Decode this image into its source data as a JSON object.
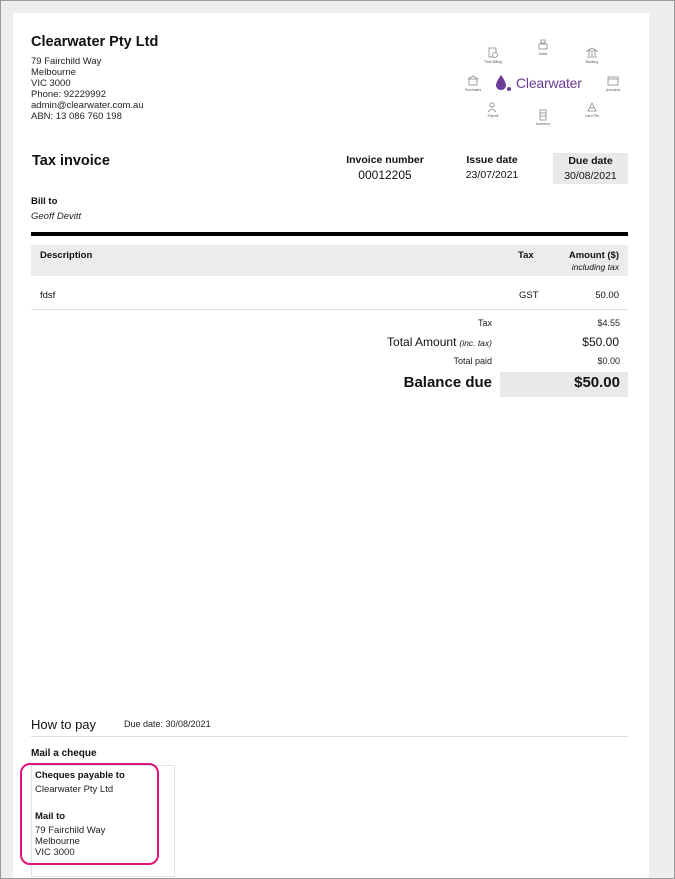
{
  "company": {
    "name": "Clearwater Pty Ltd",
    "address_line1": "79 Fairchild Way",
    "address_line2": "Melbourne",
    "address_line3": "VIC 3000",
    "phone": "Phone: 92229992",
    "email": "admin@clearwater.com.au",
    "abn": "ABN: 13 086 760 198"
  },
  "logo": {
    "brand": "Clearwater",
    "brand_color": "#6a3c96",
    "icons": [
      {
        "label": "Time Billing",
        "icon": "timer-icon"
      },
      {
        "label": "Sales",
        "icon": "cash-register-icon"
      },
      {
        "label": "Banking",
        "icon": "bank-icon"
      },
      {
        "label": "Purchases",
        "icon": "store-icon"
      },
      {
        "label": "Accounts",
        "icon": "folder-icon"
      },
      {
        "label": "Payroll",
        "icon": "people-icon"
      },
      {
        "label": "Inventory",
        "icon": "boxes-icon"
      },
      {
        "label": "Card File",
        "icon": "contacts-icon"
      }
    ]
  },
  "invoice": {
    "title": "Tax invoice",
    "number_label": "Invoice number",
    "number": "00012205",
    "issue_label": "Issue date",
    "issue_date": "23/07/2021",
    "due_label": "Due date",
    "due_date": "30/08/2021",
    "bill_to_label": "Bill to",
    "bill_to": "Geoff Devitt"
  },
  "table": {
    "col_description": "Description",
    "col_tax": "Tax",
    "col_amount": "Amount ($)",
    "col_amount_sub": "including tax",
    "rows": [
      {
        "description": "fdsf",
        "tax": "GST",
        "amount": "50.00"
      }
    ]
  },
  "totals": {
    "tax_label": "Tax",
    "tax": "$4.55",
    "total_label": "Total Amount",
    "total_note": "(inc. tax)",
    "total": "$50.00",
    "paid_label": "Total paid",
    "paid": "$0.00",
    "balance_label": "Balance due",
    "balance": "$50.00"
  },
  "how_to_pay": {
    "title": "How to pay",
    "due": "Due date: 30/08/2021",
    "method_title": "Mail a cheque",
    "payable_label": "Cheques payable to",
    "payable_to": "Clearwater Pty Ltd",
    "mail_label": "Mail to",
    "mail_line1": "79 Fairchild Way",
    "mail_line2": "Melbourne",
    "mail_line3": "VIC 3000",
    "highlight_color": "#e0157c"
  }
}
